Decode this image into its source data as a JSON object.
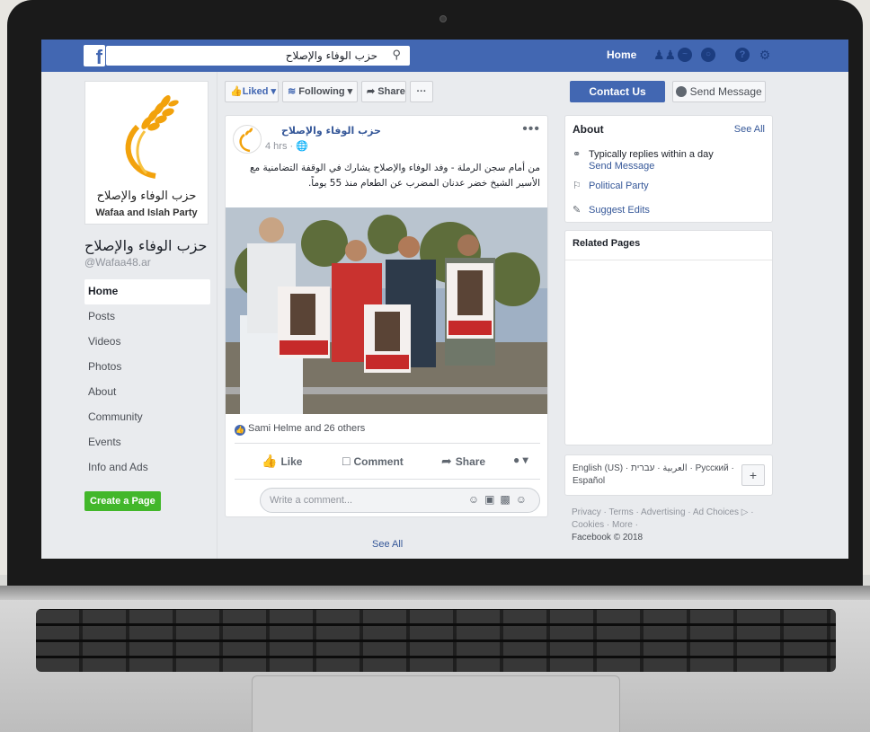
{
  "topbar": {
    "logo": "f",
    "search_value": "حزب الوفاء والإصلاح",
    "home_label": "Home",
    "icons": [
      "friends-icon",
      "messenger-icon",
      "globe-icon",
      "help-icon",
      "settings-icon"
    ]
  },
  "page": {
    "logo_ar": "حزب الوفاء والإصلاح",
    "logo_en": "Wafaa and Islah Party",
    "name": "حزب الوفاء والإصلاح",
    "handle": "@Wafaa48.ar"
  },
  "nav": {
    "items": [
      "Home",
      "Posts",
      "Videos",
      "Photos",
      "About",
      "Community",
      "Events",
      "Info and Ads"
    ],
    "create_label": "Create a Page"
  },
  "actions": {
    "liked": "Liked ▾",
    "following": "Following ▾",
    "share": "Share",
    "more": "···",
    "contact": "Contact Us",
    "send_message": "Send Message"
  },
  "post": {
    "author": "حزب الوفاء والإصلاح",
    "time": "4 hrs · ",
    "text": "من أمام سجن الرملة - وفد الوفاء والإصلاح يشارك في الوقفة التضامنية مع الأسير الشيخ خضر عدنان المضرب عن الطعام منذ 55 يوماً.",
    "likes": "Sami Helme and 26 others",
    "like_label": "Like",
    "comment_label": "Comment",
    "share_label": "Share",
    "comment_placeholder": "Write a comment...",
    "see_all": "See All"
  },
  "about": {
    "title": "About",
    "see_all": "See All",
    "replies": "Typically replies within a day",
    "send_message": "Send Message",
    "category": "Political Party",
    "suggest": "Suggest Edits"
  },
  "related": {
    "title": "Related Pages"
  },
  "language": {
    "text": "English (US) · العربية · עברית · Русский · Español",
    "plus": "+"
  },
  "footer": {
    "links": "Privacy · Terms · Advertising · Ad Choices ▷ · Cookies · More ·",
    "copyright": "Facebook © 2018"
  },
  "colors": {
    "brand": "#4267b2",
    "link": "#365899",
    "create": "#42b72a"
  }
}
